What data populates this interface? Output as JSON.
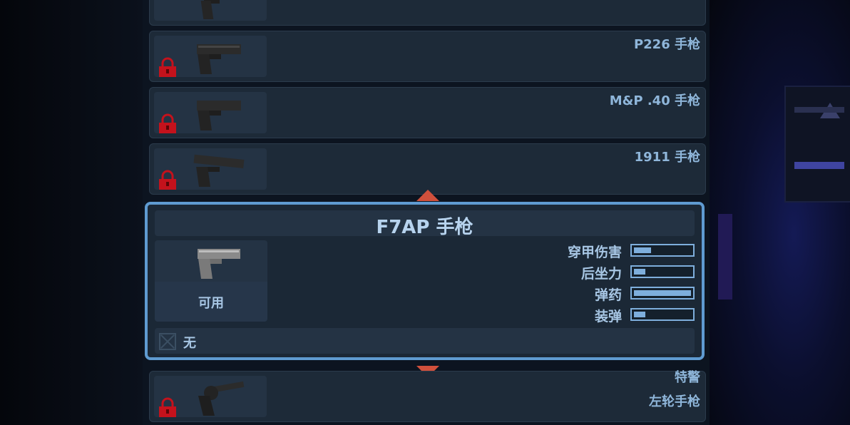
{
  "weapon_list": {
    "items": [
      {
        "name": "",
        "locked": false
      },
      {
        "name": "P226 手枪",
        "locked": true
      },
      {
        "name": "M&P .40 手枪",
        "locked": true
      },
      {
        "name": "1911 手枪",
        "locked": true
      }
    ],
    "selected": {
      "title": "F7AP 手枪",
      "status": "可用",
      "stats": [
        {
          "label": "穿甲伤害",
          "value": 0.3
        },
        {
          "label": "后坐力",
          "value": 0.2
        },
        {
          "label": "弹药",
          "value": 1.0
        },
        {
          "label": "装弹",
          "value": 0.2
        }
      ],
      "modification": "无"
    },
    "next_item": {
      "name": "特警",
      "subname": "左轮手枪",
      "locked": true
    }
  },
  "colors": {
    "accent": "#5f9bd1",
    "lock": "#c4121c",
    "arrow": "#d0503c",
    "label": "#8fb6da"
  }
}
